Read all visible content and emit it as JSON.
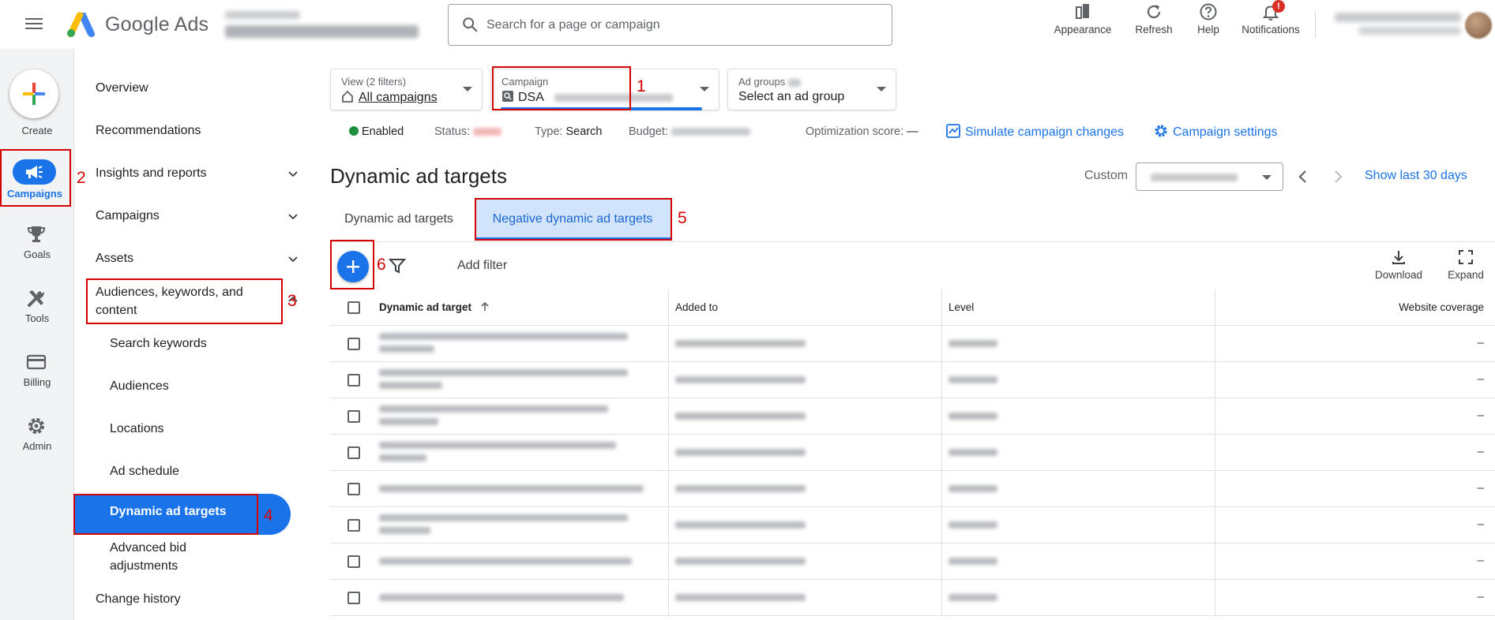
{
  "topbar": {
    "brand": "Google Ads",
    "search_placeholder": "Search for a page or campaign",
    "actions": {
      "appearance": "Appearance",
      "refresh": "Refresh",
      "help": "Help",
      "notifications": "Notifications"
    },
    "notification_badge": "!"
  },
  "rail": {
    "create": "Create",
    "campaigns": "Campaigns",
    "goals": "Goals",
    "tools": "Tools",
    "billing": "Billing",
    "admin": "Admin"
  },
  "nav": {
    "overview": "Overview",
    "recommendations": "Recommendations",
    "insights": "Insights and reports",
    "campaigns": "Campaigns",
    "assets": "Assets",
    "audiences_line1": "Audiences, keywords, and",
    "audiences_line2": "content",
    "search_keywords": "Search keywords",
    "audiences": "Audiences",
    "locations": "Locations",
    "ad_schedule": "Ad schedule",
    "dynamic_ad_targets": "Dynamic ad targets",
    "advanced_bid_line1": "Advanced bid",
    "advanced_bid_line2": "adjustments",
    "change_history": "Change history"
  },
  "annotations": [
    "1",
    "2",
    "3",
    "4",
    "5",
    "6"
  ],
  "selectors": {
    "view_label": "View (2 filters)",
    "view_value": "All campaigns",
    "campaign_label": "Campaign",
    "campaign_value": "DSA",
    "adgroups_label": "Ad groups",
    "adgroups_value": "Select an ad group"
  },
  "status": {
    "enabled": "Enabled",
    "status_label": "Status:",
    "type_label": "Type:",
    "type_value": "Search",
    "budget_label": "Budget:",
    "optimization_label": "Optimization score:",
    "optimization_value": "—",
    "simulate": "Simulate campaign changes",
    "settings": "Campaign settings"
  },
  "page": {
    "title": "Dynamic ad targets",
    "date_label": "Custom",
    "show_last": "Show last 30 days"
  },
  "tabs": {
    "dynamic": "Dynamic ad targets",
    "negative": "Negative dynamic ad targets"
  },
  "toolbar": {
    "add_filter": "Add filter",
    "download": "Download",
    "expand": "Expand"
  },
  "table": {
    "columns": [
      "Dynamic ad target",
      "Added to",
      "Level",
      "Website coverage"
    ],
    "rows": [
      {
        "coverage": "–"
      },
      {
        "coverage": "–"
      },
      {
        "coverage": "–"
      },
      {
        "coverage": "–"
      },
      {
        "coverage": "–"
      },
      {
        "coverage": "–"
      },
      {
        "coverage": "–"
      },
      {
        "coverage": "–"
      }
    ]
  },
  "colors": {
    "accent": "#1a73e8",
    "annotation": "#d50000",
    "enabled_dot": "#1e8e3e",
    "tab_active_bg": "#d2e3fc"
  }
}
